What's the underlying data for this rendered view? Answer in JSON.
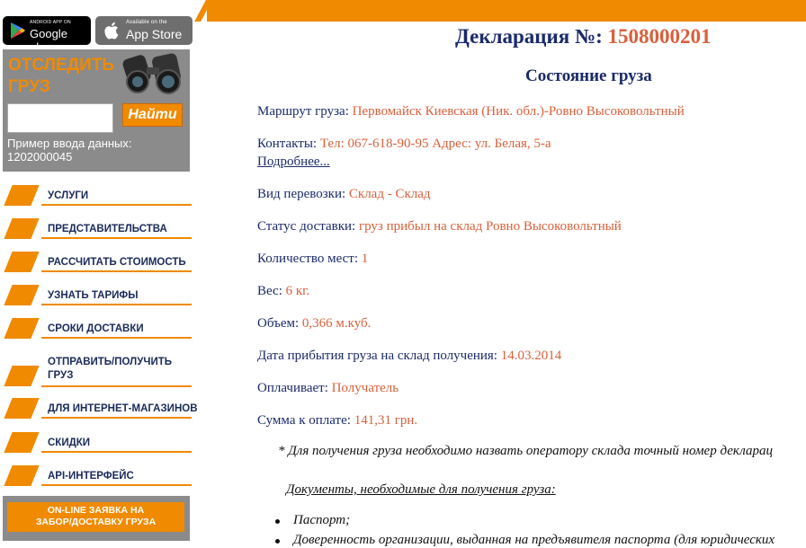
{
  "store_badges": {
    "google": {
      "small": "Android app on",
      "big": "Google play"
    },
    "apple": {
      "small": "Available on the",
      "big": "App Store"
    }
  },
  "tracking": {
    "title_line1": "ОТСЛЕДИТЬ",
    "title_line2": "ГРУЗ",
    "input_value": "",
    "button": "Найти",
    "example_label": "Пример ввода данных:",
    "example_value": "1202000045"
  },
  "menu": [
    {
      "label": "УСЛУГИ"
    },
    {
      "label": "ПРЕДСТАВИТЕЛЬСТВА"
    },
    {
      "label": "РАССЧИТАТЬ СТОИМОСТЬ"
    },
    {
      "label": "УЗНАТЬ ТАРИФЫ"
    },
    {
      "label": "СРОКИ ДОСТАВКИ"
    },
    {
      "label": "ОТПРАВИТЬ/ПОЛУЧИТЬ",
      "label2": "ГРУЗ"
    },
    {
      "label": "ДЛЯ ИНТЕРНЕТ-МАГАЗИНОВ"
    },
    {
      "label": "СКИДКИ"
    },
    {
      "label": "API-ИНТЕРФЕЙС"
    }
  ],
  "online_request": {
    "line1": "ON-LINE ЗАЯВКА НА",
    "line2": "ЗАБОР/ДОСТАВКУ ГРУЗА"
  },
  "declaration": {
    "label": "Декларация №:",
    "number": "1508000201"
  },
  "state_title": "Состояние груза",
  "details": {
    "route": {
      "label": "Маршрут груза:",
      "value": "Первомайск Киевская (Ник. обл.)-Ровно Высоковольтный"
    },
    "contacts": {
      "label": "Контакты:",
      "value": "Тел: 067-618-90-95 Адрес: ул. Белая, 5-а"
    },
    "more_link": "Подробнее...",
    "transport": {
      "label": "Вид перевозки:",
      "value": "Склад - Склад"
    },
    "status": {
      "label": "Статус доставки:",
      "value": "груз прибыл на склад Ровно Высоковольтный"
    },
    "places": {
      "label": "Количество мест:",
      "value": "1"
    },
    "weight": {
      "label": "Вес:",
      "value": "6 кг."
    },
    "volume": {
      "label": "Объем:",
      "value": "0,366 м.куб."
    },
    "arrival": {
      "label": "Дата прибытия груза на склад получения:",
      "value": "14.03.2014"
    },
    "payer": {
      "label": "Оплачивает:",
      "value": "Получатель"
    },
    "sum": {
      "label": "Сумма к оплате:",
      "value": "141,31 грн."
    }
  },
  "note": "* Для получения груза необходимо назвать оператору склада точный номер декларац",
  "documents": {
    "title": "Документы, необходимые для получения груза:",
    "items": [
      "Паспорт;",
      "Доверенность организации, выданная на предъявителя паспорта (для юридических"
    ]
  },
  "colors": {
    "accent": "#f08a00",
    "value_text": "#d9603b",
    "label_text": "#1a2a6a",
    "panel_gray": "#8b8b8b"
  }
}
